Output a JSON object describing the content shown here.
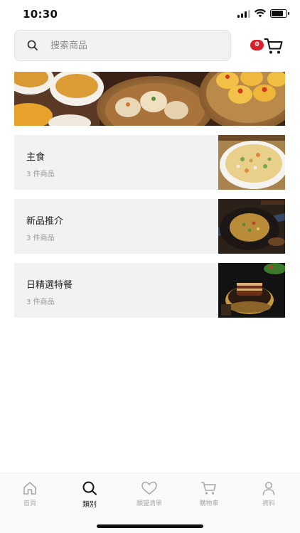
{
  "status_bar": {
    "time": "10:30"
  },
  "search": {
    "placeholder": "搜索商品"
  },
  "cart": {
    "badge_count": "0"
  },
  "categories": [
    {
      "name": "主食",
      "count": "3 件商品"
    },
    {
      "name": "新品推介",
      "count": "3 件商品"
    },
    {
      "name": "日精選特餐",
      "count": "3 件商品"
    }
  ],
  "bottom_nav": {
    "items": [
      {
        "label": "首頁",
        "icon": "home-icon"
      },
      {
        "label": "類別",
        "icon": "search-icon"
      },
      {
        "label": "願望清單",
        "icon": "heart-icon"
      },
      {
        "label": "購物車",
        "icon": "cart-icon"
      },
      {
        "label": "資料",
        "icon": "user-icon"
      }
    ],
    "active_index": 1
  },
  "colors": {
    "badge": "#d6232b",
    "card_bg": "#f2f2f2",
    "inactive_nav": "#a8a8a8"
  }
}
